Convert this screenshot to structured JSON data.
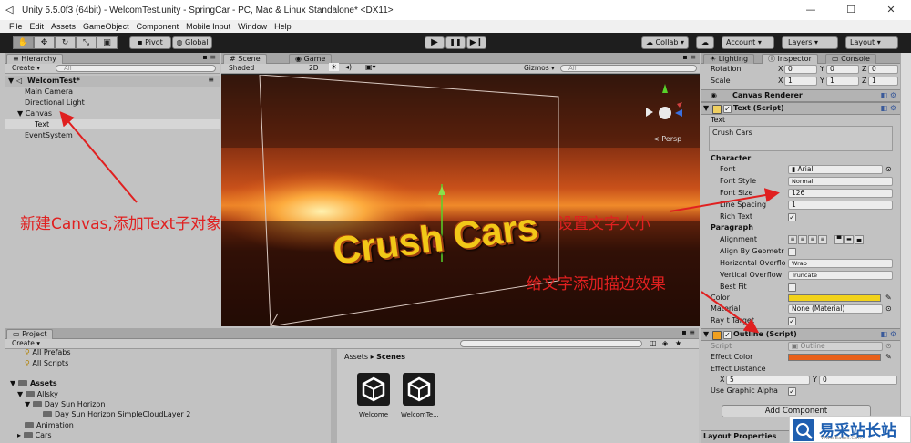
{
  "window": {
    "title": "Unity 5.5.0f3 (64bit) - WelcomTest.unity - SpringCar - PC, Mac & Linux Standalone* <DX11>",
    "minimize": "—",
    "maximize": "☐",
    "close": "✕"
  },
  "menu": [
    "File",
    "Edit",
    "Assets",
    "GameObject",
    "Component",
    "Mobile Input",
    "Window",
    "Help"
  ],
  "toolbar": {
    "pivot": "Pivot",
    "global": "Global",
    "collab": "Collab ▾",
    "account": "Account ▾",
    "layers": "Layers ▾",
    "layout": "Layout ▾"
  },
  "hierarchy": {
    "tab": "Hierarchy",
    "create": "Create ▾",
    "search_placeholder": "All",
    "scene": "WelcomTest*",
    "items": [
      "Main Camera",
      "Directional Light",
      "Canvas",
      "Text",
      "EventSystem"
    ]
  },
  "scene_view": {
    "tab_scene": "Scene",
    "tab_game": "Game",
    "shading": "Shaded",
    "mode_2d": "2D",
    "gizmos": "Gizmos ▾",
    "search_placeholder": "All",
    "persp": "< Persp",
    "ui_text": "Crush Cars"
  },
  "inspector": {
    "tab_lighting": "Lighting",
    "tab_inspector": "Inspector",
    "tab_console": "Console",
    "rotation_label": "Rotation",
    "rotation": {
      "x": "0",
      "y": "0",
      "z": "0"
    },
    "scale_label": "Scale",
    "scale": {
      "x": "1",
      "y": "1",
      "z": "1"
    },
    "canvas_renderer": "Canvas Renderer",
    "text_script": "Text (Script)",
    "text_label": "Text",
    "text_value": "Crush Cars",
    "character": "Character",
    "font_label": "Font",
    "font_value": "Arial",
    "font_style_label": "Font Style",
    "font_style_value": "Normal",
    "font_size_label": "Font Size",
    "font_size_value": "126",
    "line_spacing_label": "Line Spacing",
    "line_spacing_value": "1",
    "rich_text_label": "Rich Text",
    "paragraph": "Paragraph",
    "alignment_label": "Alignment",
    "align_by_geometry_label": "Align By Geometr",
    "horizontal_overflow_label": "Horizontal Overflo",
    "horizontal_overflow_value": "Wrap",
    "vertical_overflow_label": "Vertical Overflow",
    "vertical_overflow_value": "Truncate",
    "best_fit_label": "Best Fit",
    "color_label": "Color",
    "material_label": "Material",
    "material_value": "None (Material)",
    "raycast_label": "Ray  t Target",
    "outline_script": "Outline (Script)",
    "script_label": "Script",
    "script_value": "Outline",
    "effect_color_label": "Effect Color",
    "effect_distance_label": "Effect Distance",
    "effect_distance": {
      "x": "5",
      "y": "0"
    },
    "use_graphic_alpha_label": "Use Graphic Alpha",
    "add_component": "Add Component",
    "layout_properties": "Layout Properties",
    "colors": {
      "text_color": "#f2d21a",
      "effect_color": "#e8601a"
    }
  },
  "project": {
    "tab": "Project",
    "create": "Create ▾",
    "tree": [
      "All Prefabs",
      "All Scripts",
      "Assets",
      "Allsky",
      "Day Sun Horizon",
      "Day Sun Horizon SimpleCloudLayer 2",
      "Animation",
      "Cars"
    ],
    "breadcrumb_root": "Assets",
    "breadcrumb_sep": "▸",
    "breadcrumb_current": "Scenes",
    "files": [
      "Welcome",
      "WelcomTe..."
    ]
  },
  "annotations": {
    "left": "新建Canvas,添加Text子对象",
    "size": "设置文字大小",
    "outline": "给文字添加描边效果"
  },
  "watermark": {
    "brand": "易采站长站",
    "url": "Www.Easck.Com"
  }
}
